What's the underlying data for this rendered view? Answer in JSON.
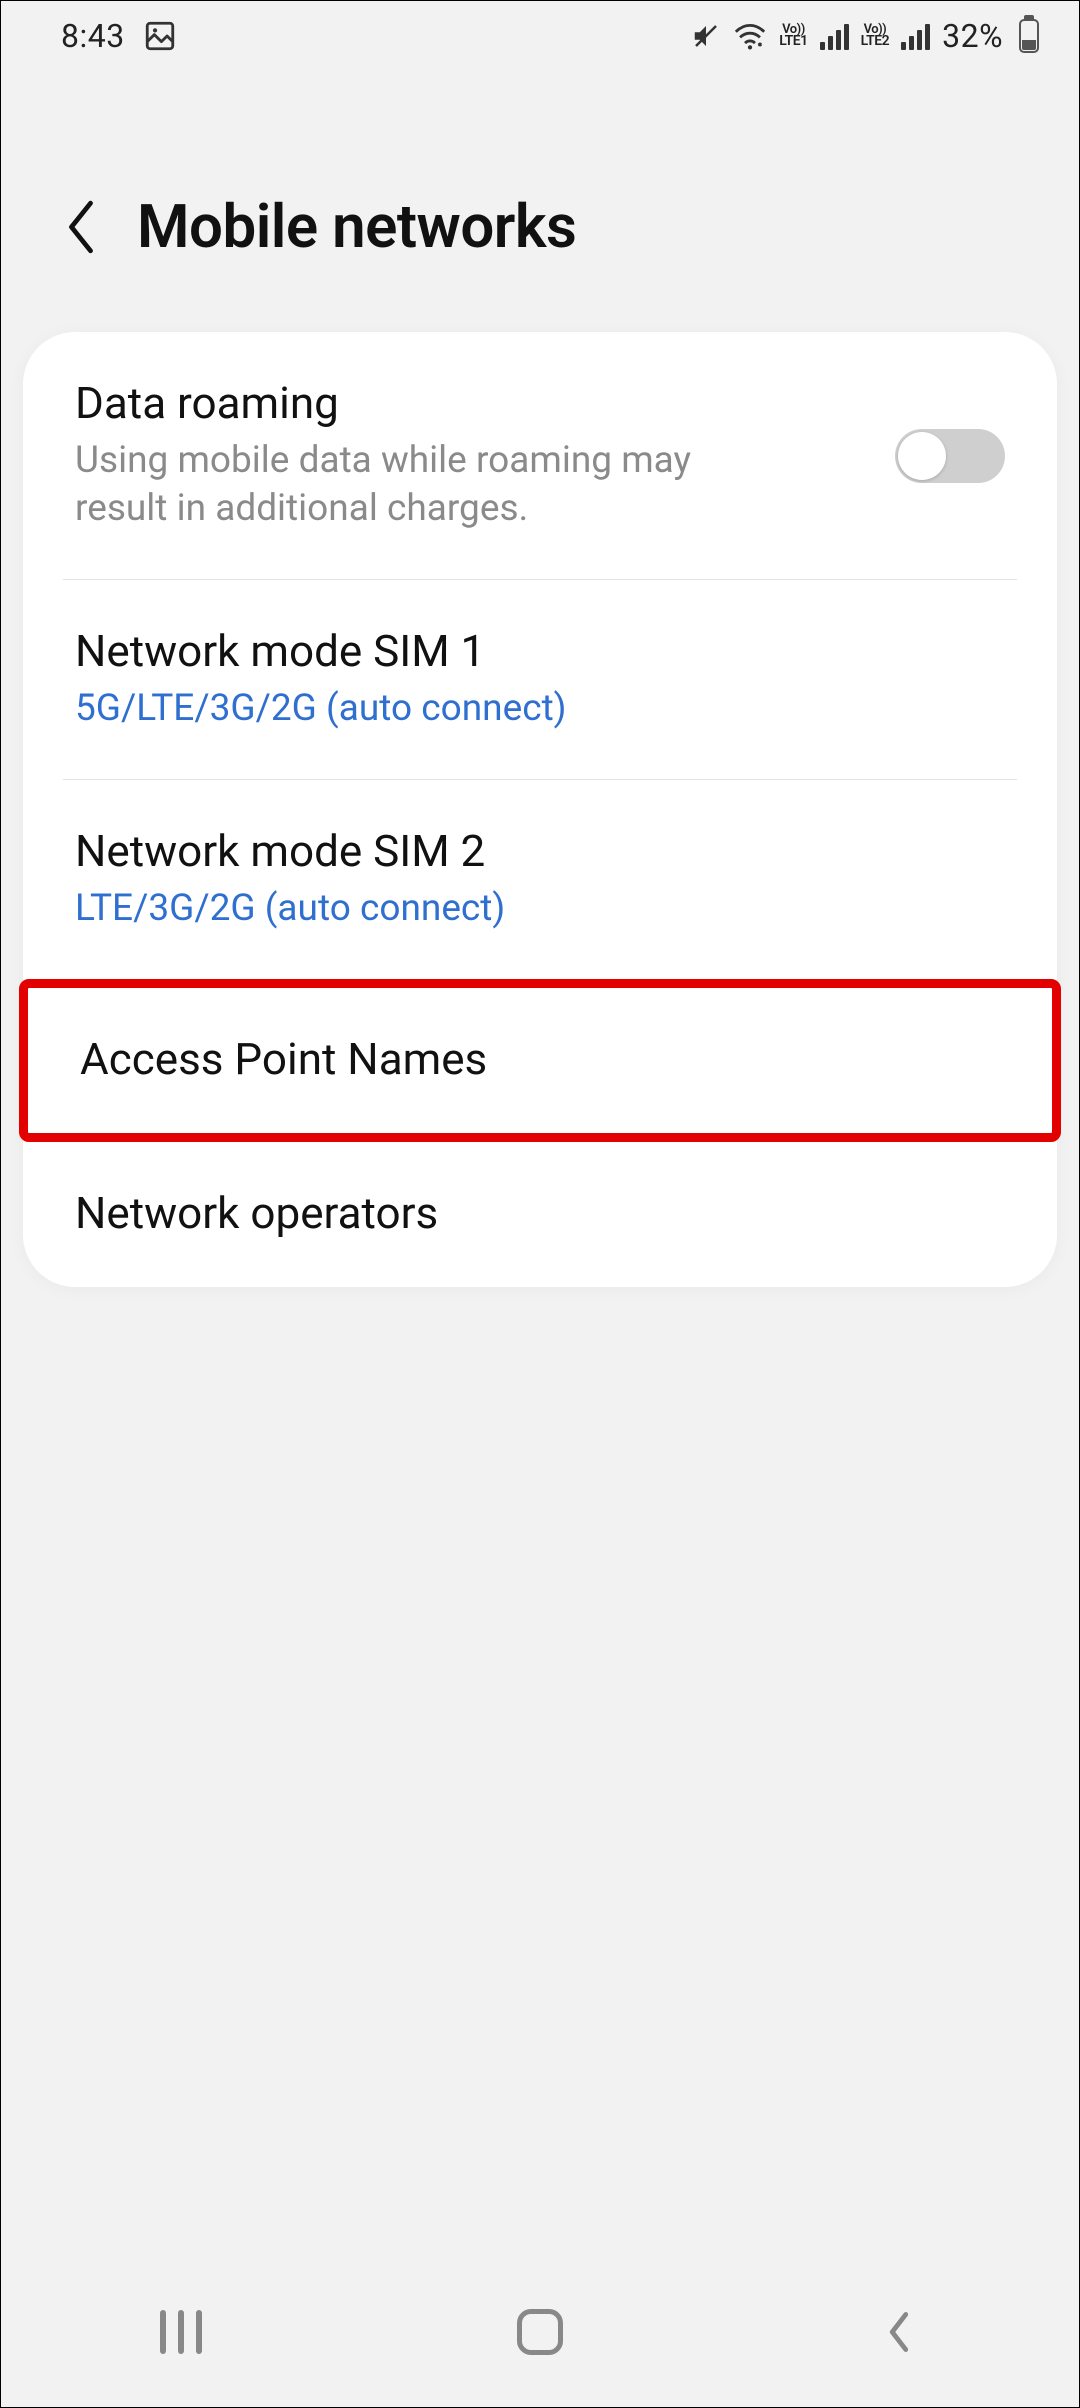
{
  "status": {
    "time": "8:43",
    "battery_percent": "32%",
    "battery_level_pct": 32,
    "sim1_label_top": "Vo))",
    "sim1_label_bot": "LTE1",
    "sim2_label_top": "Vo))",
    "sim2_label_bot": "LTE2"
  },
  "header": {
    "title": "Mobile networks"
  },
  "items": {
    "data_roaming": {
      "title": "Data roaming",
      "subtitle": "Using mobile data while roaming may result in additional charges.",
      "toggle_on": false
    },
    "sim1": {
      "title": "Network mode SIM 1",
      "subtitle": "5G/LTE/3G/2G (auto connect)"
    },
    "sim2": {
      "title": "Network mode SIM 2",
      "subtitle": "LTE/3G/2G (auto connect)"
    },
    "apn": {
      "title": "Access Point Names"
    },
    "operators": {
      "title": "Network operators"
    }
  },
  "annotation": {
    "highlight_item": "apn"
  }
}
